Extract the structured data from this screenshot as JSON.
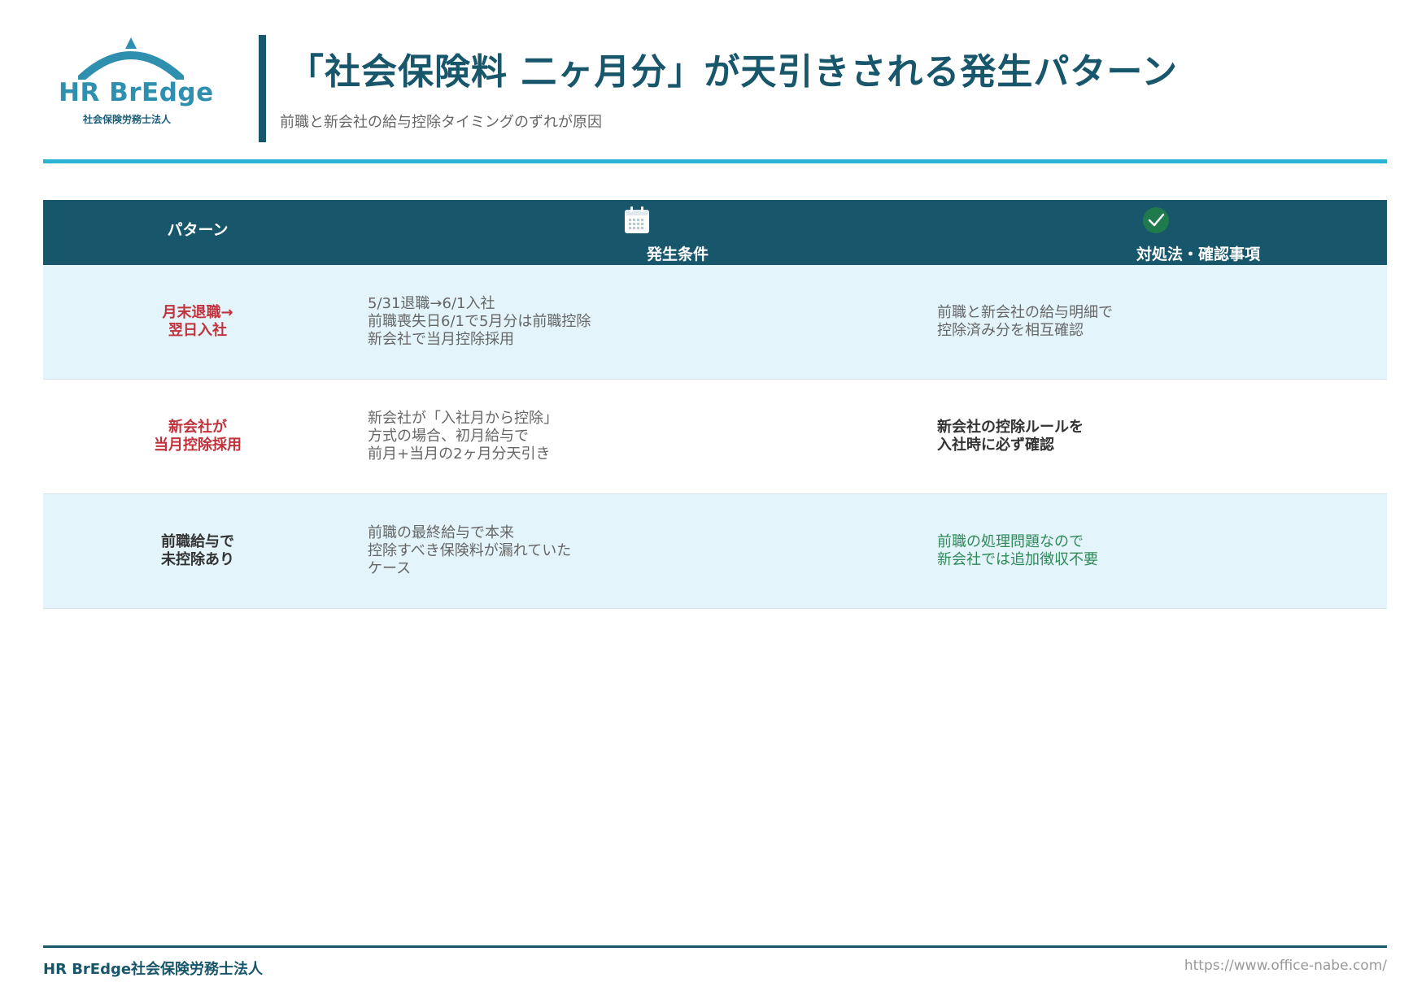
{
  "logo": {
    "name": "HR BrEdge",
    "sub": "社会保険労務士法人",
    "color": "#2f8fae"
  },
  "header": {
    "title": "「社会保険料 二ヶ月分」が天引きされる発生パターン",
    "subtitle": "前職と新会社の給与控除タイミングのずれが原因",
    "accent": "#17566b",
    "rule_color": "#2cb3d3"
  },
  "table": {
    "columns": {
      "pattern": "パターン",
      "condition": "発生条件",
      "condition_icon": "calendar-icon",
      "action": "対処法・確認事項",
      "action_icon": "check-circle-icon"
    },
    "rows": [
      {
        "pattern": [
          "月末退職→",
          "翌日入社"
        ],
        "pattern_color": "#c0323c",
        "condition": [
          "5/31退職→6/1入社",
          "前職喪失日6/1で5月分は前職控除",
          "新会社で当月控除採用"
        ],
        "action": [
          "前職と新会社の給与明細で",
          "控除済み分を相互確認"
        ],
        "action_style": "grey"
      },
      {
        "pattern": [
          "新会社が",
          "当月控除採用"
        ],
        "pattern_color": "#c0323c",
        "condition": [
          "新会社が「入社月から控除」",
          "方式の場合、初月給与で",
          "前月+当月の2ヶ月分天引き"
        ],
        "action": [
          "新会社の控除ルールを",
          "入社時に必ず確認"
        ],
        "action_style": "bold"
      },
      {
        "pattern": [
          "前職給与で",
          "未控除あり"
        ],
        "pattern_color": "#333333",
        "condition": [
          "前職の最終給与で本来",
          "控除すべき保険料が漏れていた",
          "ケース"
        ],
        "action": [
          "前職の処理問題なので",
          "新会社では追加徴収不要"
        ],
        "action_style": "green"
      }
    ]
  },
  "footer": {
    "left": "HR BrEdge社会保険労務士法人",
    "right": "https://www.office-nabe.com/"
  }
}
